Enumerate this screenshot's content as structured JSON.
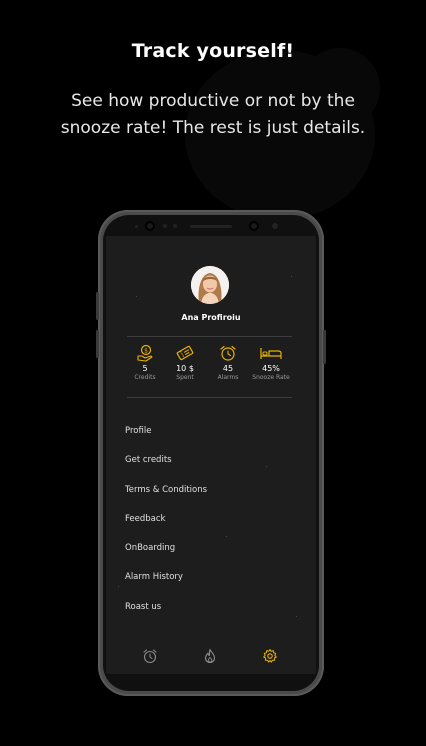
{
  "headline": "Track yourself!",
  "subline": "See how productive or not by the snooze rate! The rest is just details.",
  "profile": {
    "name": "Ana Profiroiu"
  },
  "stats": [
    {
      "icon": "coin-hand-icon",
      "value": "5",
      "label": "Credits"
    },
    {
      "icon": "ticket-icon",
      "value": "10 $",
      "label": "Spent"
    },
    {
      "icon": "alarm-clock-icon",
      "value": "45",
      "label": "Alarms"
    },
    {
      "icon": "bed-icon",
      "value": "45%",
      "label": "Snooze Rate"
    }
  ],
  "menu": [
    "Profile",
    "Get credits",
    "Terms & Conditions",
    "Feedback",
    "OnBoarding",
    "Alarm History",
    "Roast us"
  ],
  "tabs": [
    {
      "icon": "alarm-clock-icon",
      "active": false
    },
    {
      "icon": "flame-icon",
      "active": false
    },
    {
      "icon": "gear-icon",
      "active": true
    }
  ],
  "colors": {
    "accent": "#e8b300",
    "background": "#000000",
    "screen": "#1d1d1d",
    "muted": "#9a9a9a"
  }
}
